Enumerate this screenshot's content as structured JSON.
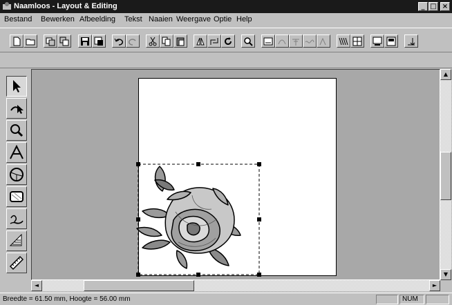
{
  "window": {
    "title": "Naamloos - Layout & Editing",
    "buttons": {
      "minimize": "_",
      "maximize": "□",
      "close": "×"
    }
  },
  "menu": [
    {
      "label": "Bestand",
      "name": "menu-bestand"
    },
    {
      "label": "Bewerken",
      "name": "menu-bewerken"
    },
    {
      "label": "Afbeelding",
      "name": "menu-afbeelding"
    },
    {
      "label": "Tekst",
      "name": "menu-tekst"
    },
    {
      "label": "Naaien",
      "name": "menu-naaien"
    },
    {
      "label": "Weergave",
      "name": "menu-weergave"
    },
    {
      "label": "Optie",
      "name": "menu-optie"
    },
    {
      "label": "Help",
      "name": "menu-help"
    }
  ],
  "toolbar": [
    "new-file-icon",
    "open-file-icon",
    "import-icon",
    "import-2-icon",
    "save-icon",
    "save-as-icon",
    "undo-icon",
    "redo-icon",
    "cut-icon",
    "copy-icon",
    "paste-icon",
    "mirror-icon",
    "rotate-icon",
    "refresh-icon",
    "preview-icon",
    "text-abc-icon",
    "text-effect-icon",
    "text-path-icon",
    "text-wave-icon",
    "text-abc2-icon",
    "stitch-fill-icon",
    "stitch-pattern-icon",
    "monitor-icon",
    "card-icon",
    "sew-icon"
  ],
  "tools": [
    "select-arrow-icon",
    "point-edit-icon",
    "zoom-icon",
    "text-tool-icon",
    "circle-tool-icon",
    "rectangle-tool-icon",
    "line-tool-icon",
    "stitch-tool-icon",
    "measure-tool-icon"
  ],
  "status": {
    "dimensions": "Breedte  = 61.50 mm, Hoogte = 56.00 mm",
    "num": "NUM"
  },
  "scrollbars": {
    "up": "▲",
    "down": "▼",
    "left": "◄",
    "right": "►"
  }
}
